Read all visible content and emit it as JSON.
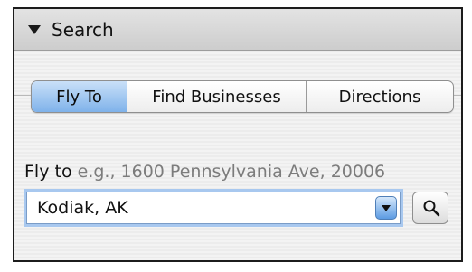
{
  "panel": {
    "title": "Search"
  },
  "tabs": [
    {
      "label": "Fly To",
      "active": true
    },
    {
      "label": "Find Businesses",
      "active": false
    },
    {
      "label": "Directions",
      "active": false
    }
  ],
  "fly_to": {
    "label": "Fly to",
    "hint": "e.g., 1600 Pennsylvania Ave, 20006",
    "value": "Kodiak, AK"
  },
  "icons": {
    "disclosure": "triangle-down-icon",
    "dropdown": "chevron-down-icon",
    "search": "magnifier-icon"
  },
  "colors": {
    "active_tab": "#8fbdf0",
    "focus_ring": "#a8c8ef"
  }
}
